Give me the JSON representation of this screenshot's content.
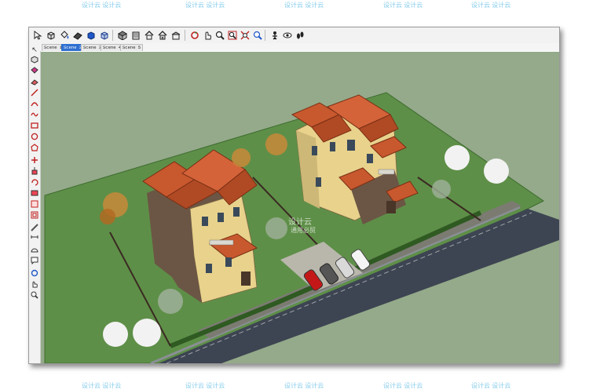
{
  "watermark": "设计云 设计云",
  "scene_tabs": [
    "Scene 1",
    "Scene 2",
    "Scene 3",
    "Scene 4",
    "Scene 5"
  ],
  "active_scene": "Scene 2",
  "center_watermark": [
    "设计云",
    "通用必贸"
  ],
  "toolbar_icons": [
    "select-arrow",
    "component",
    "paint-bucket",
    "eraser",
    "view-iso",
    "view-top",
    "view-front",
    "view-right",
    "view-back",
    "view-left",
    "xray",
    "orbit",
    "pan",
    "zoom",
    "zoom-window",
    "zoom-extents",
    "previous-view",
    "position-camera",
    "walk",
    "look-around"
  ],
  "left_tool_icons": [
    "select",
    "line",
    "arc",
    "rectangle",
    "circle",
    "polygon",
    "freehand",
    "eraser",
    "tape",
    "dimension",
    "protractor",
    "text",
    "axes",
    "3d-text",
    "move",
    "rotate",
    "scale",
    "push-pull",
    "follow-me",
    "offset",
    "paint",
    "orbit",
    "pan",
    "zoom"
  ],
  "colors": {
    "grass": "#5e8f48",
    "background": "#94aa8a",
    "road": "#3d4452",
    "roof": "#c8582e",
    "wall": "#e8d28c",
    "stone": "#6b5645"
  }
}
